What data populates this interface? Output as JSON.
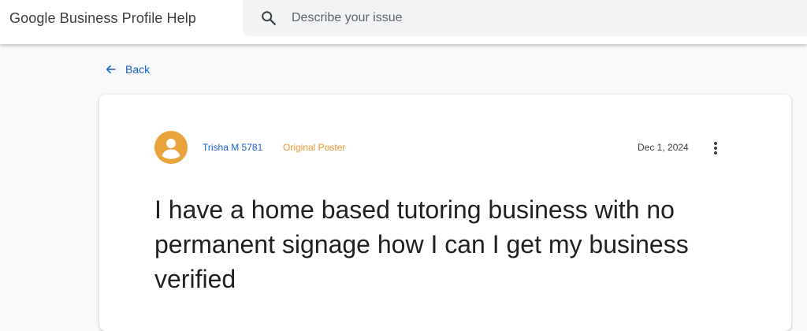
{
  "header": {
    "app_title": "Google Business Profile Help",
    "search": {
      "placeholder": "Describe your issue",
      "icon": "search-icon"
    }
  },
  "nav": {
    "back_label": "Back",
    "back_icon": "arrow-left-icon"
  },
  "post": {
    "author": {
      "name": "Trisha M 5781",
      "badge": "Original Poster",
      "avatar_icon": "person-avatar-icon"
    },
    "date": "Dec 1, 2024",
    "more_icon": "more-vertical-icon",
    "title": "I have a home based tutoring business with no permanent signage how I can I get my business verified"
  },
  "colors": {
    "link_blue": "#1a5fd0",
    "badge_orange": "#e69a2c",
    "avatar_orange": "#e8a33d",
    "search_bg": "#f1f3f4",
    "page_bg": "#f8f9fa"
  }
}
